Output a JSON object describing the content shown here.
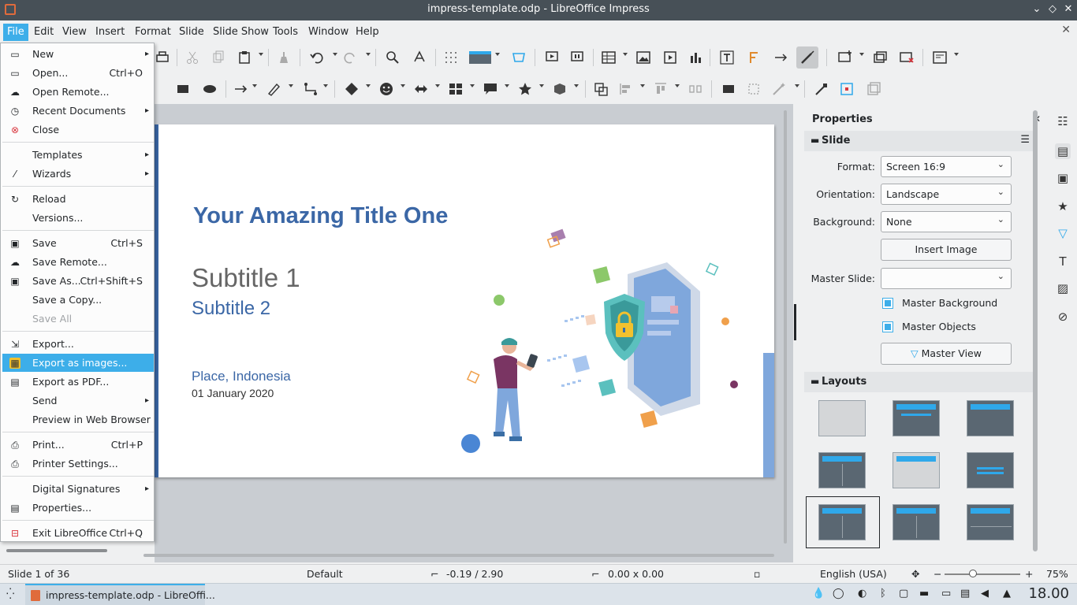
{
  "window": {
    "title": "impress-template.odp - LibreOffice Impress"
  },
  "menubar": {
    "items": [
      "File",
      "Edit",
      "View",
      "Insert",
      "Format",
      "Slide",
      "Slide Show",
      "Tools",
      "Window",
      "Help"
    ]
  },
  "file_menu": {
    "items": [
      {
        "label": "New",
        "shortcut": "",
        "submenu": true,
        "icon": "new-icon"
      },
      {
        "label": "Open...",
        "shortcut": "Ctrl+O",
        "icon": "folder-icon"
      },
      {
        "label": "Open Remote...",
        "shortcut": "",
        "icon": "cloud-icon"
      },
      {
        "label": "Recent Documents",
        "shortcut": "",
        "submenu": true,
        "icon": "clock-icon"
      },
      {
        "label": "Close",
        "shortcut": "",
        "icon": "close-circle-icon"
      },
      {
        "label": "Templates",
        "shortcut": "",
        "submenu": true,
        "icon": ""
      },
      {
        "label": "Wizards",
        "shortcut": "",
        "submenu": true,
        "icon": "wand-icon"
      },
      {
        "label": "Reload",
        "shortcut": "",
        "icon": "reload-icon"
      },
      {
        "label": "Versions...",
        "shortcut": "",
        "icon": ""
      },
      {
        "label": "Save",
        "shortcut": "Ctrl+S",
        "icon": "save-icon"
      },
      {
        "label": "Save Remote...",
        "shortcut": "",
        "icon": "cloud-icon"
      },
      {
        "label": "Save As...",
        "shortcut": "Ctrl+Shift+S",
        "icon": "save-as-icon"
      },
      {
        "label": "Save a Copy...",
        "shortcut": "",
        "icon": ""
      },
      {
        "label": "Save All",
        "shortcut": "",
        "icon": "",
        "disabled": true
      },
      {
        "label": "Export...",
        "shortcut": "",
        "icon": "export-icon"
      },
      {
        "label": "Export as images...",
        "shortcut": "",
        "icon": "export-image-icon",
        "highlighted": true
      },
      {
        "label": "Export as PDF...",
        "shortcut": "",
        "icon": "pdf-icon"
      },
      {
        "label": "Send",
        "shortcut": "",
        "submenu": true,
        "icon": ""
      },
      {
        "label": "Preview in Web Browser",
        "shortcut": "",
        "icon": ""
      },
      {
        "label": "Print...",
        "shortcut": "Ctrl+P",
        "icon": "print-icon"
      },
      {
        "label": "Printer Settings...",
        "shortcut": "",
        "icon": "printer-settings-icon"
      },
      {
        "label": "Digital Signatures",
        "shortcut": "",
        "submenu": true,
        "icon": ""
      },
      {
        "label": "Properties...",
        "shortcut": "",
        "icon": "properties-icon"
      },
      {
        "label": "Exit LibreOffice",
        "shortcut": "Ctrl+Q",
        "icon": "exit-icon"
      }
    ]
  },
  "slide": {
    "title": "Your Amazing Title One",
    "subtitle1": "Subtitle 1",
    "subtitle2": "Subtitle 2",
    "place": "Place, Indonesia",
    "date": "01 January 2020"
  },
  "sidebar": {
    "panel_title": "Properties",
    "slide_section": "Slide",
    "format_label": "Format:",
    "format_value": "Screen 16:9",
    "orientation_label": "Orientation:",
    "orientation_value": "Landscape",
    "background_label": "Background:",
    "background_value": "None",
    "insert_image_label": "Insert Image",
    "master_slide_label": "Master Slide:",
    "master_slide_value": "",
    "master_background_label": "Master Background",
    "master_objects_label": "Master Objects",
    "master_view_label": "Master View",
    "layouts_section": "Layouts"
  },
  "statusbar": {
    "slide_info": "Slide 1 of 36",
    "master": "Default",
    "position": "-0.19 / 2.90",
    "size": "0.00 x 0.00",
    "language": "English (USA)",
    "zoom": "75%"
  },
  "taskbar": {
    "task_label": "impress-template.odp - LibreOffi...",
    "clock": "18.00"
  },
  "colors": {
    "accent": "#3daee9",
    "slide_title": "#3b67a6",
    "titlebar": "#475057"
  }
}
